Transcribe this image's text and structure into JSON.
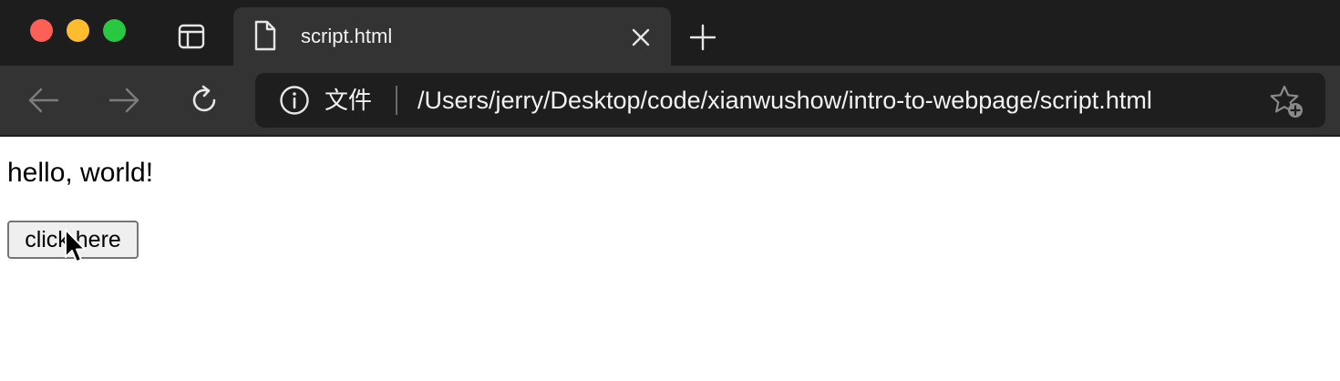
{
  "browser": {
    "active_tab": {
      "title": "script.html",
      "icon": "document-icon"
    },
    "address_bar": {
      "security_label": "文件",
      "url": "/Users/jerry/Desktop/code/xianwushow/intro-to-webpage/script.html"
    },
    "icons": {
      "sidebar": "sidebar-icon",
      "close_tab": "close-icon",
      "new_tab": "plus-icon",
      "back": "arrow-left-icon",
      "forward": "arrow-right-icon",
      "reload": "reload-icon",
      "info": "info-icon",
      "favorite": "star-plus-icon"
    },
    "colors": {
      "tab_bar": "#1d1d1d",
      "toolbar": "#333333",
      "address_field": "#1e1e1e",
      "close_dot": "#fe5f57",
      "minimize_dot": "#febc2e",
      "zoom_dot": "#28c840"
    }
  },
  "page": {
    "heading": "hello, world!",
    "button_label": "click here"
  }
}
